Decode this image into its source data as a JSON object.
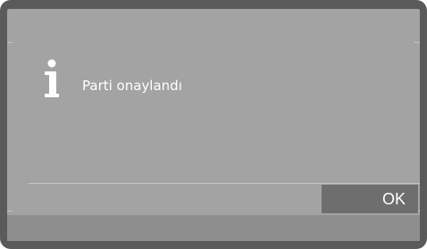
{
  "dialog": {
    "icon": "info-icon",
    "message": "Parti onaylandı",
    "ok_label": "OK"
  },
  "colors": {
    "bezel": "#5a5a5a",
    "screen": "#a3a3a3",
    "button": "#6e6e6e",
    "text": "#ffffff"
  }
}
